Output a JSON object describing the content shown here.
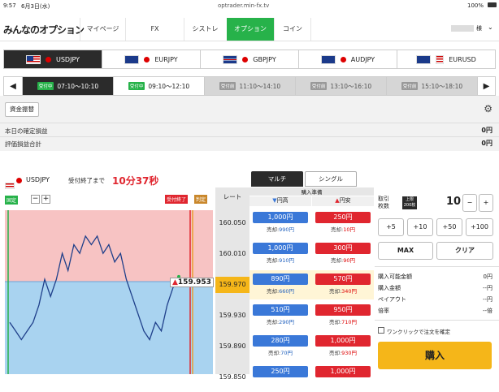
{
  "status": {
    "time": "9:57",
    "date": "6月3日(水)",
    "url": "optrader.min-fx.tv",
    "battery": "100%"
  },
  "nav": {
    "logo": "みんなのオプション",
    "items": [
      "マイページ",
      "FX",
      "シストレ",
      "オプション",
      "コイン"
    ],
    "active": "オプション",
    "user": "様"
  },
  "pairs": [
    "USDJPY",
    "EURJPY",
    "GBPJPY",
    "AUDJPY",
    "EURUSD"
  ],
  "active_pair": "USDJPY",
  "time_slots": [
    {
      "badge": "受付中",
      "time": "07:10〜10:10",
      "state": "dark"
    },
    {
      "badge": "受付中",
      "time": "09:10〜12:10",
      "state": "white"
    },
    {
      "badge": "受付前",
      "time": "11:10〜14:10",
      "state": "gray"
    },
    {
      "badge": "受付前",
      "time": "13:10〜16:10",
      "state": "gray"
    },
    {
      "badge": "受付前",
      "time": "15:10〜18:10",
      "state": "gray"
    }
  ],
  "account": {
    "transfer_label": "資金振替",
    "confirmed_label": "本日の確定損益",
    "confirmed_value": "0円",
    "valuation_label": "評価損益合計",
    "valuation_value": "0円"
  },
  "chart": {
    "pair": "USDJPY",
    "deadline_label": "受付終了まで",
    "countdown": "10分37秒",
    "scale_label": "固定",
    "end_label": "受付終了",
    "judge_label": "判定",
    "current_price": "159.953",
    "price_series": [
      159.9,
      159.89,
      159.88,
      159.89,
      159.9,
      159.92,
      159.95,
      159.93,
      159.95,
      159.98,
      159.96,
      159.99,
      159.98,
      160.0,
      159.99,
      160.0,
      159.98,
      159.99,
      159.97,
      159.98,
      159.95,
      159.93,
      159.91,
      159.89,
      159.88,
      159.9,
      159.89,
      159.92,
      159.94,
      159.953
    ]
  },
  "tabs": {
    "multi": "マルチ",
    "single": "シングル"
  },
  "table": {
    "rate_header": "レート",
    "ready_header": "購入準備",
    "high_header": "円高",
    "low_header": "円安",
    "rows": [
      {
        "rate": "160.050",
        "high": "1,000円",
        "high_sell": "990円",
        "low": "250円",
        "low_sell": "10円"
      },
      {
        "rate": "160.010",
        "high": "1,000円",
        "high_sell": "910円",
        "low": "300円",
        "low_sell": "90円"
      },
      {
        "rate": "159.970",
        "high": "890円",
        "high_sell": "660円",
        "low": "570円",
        "low_sell": "340円"
      },
      {
        "rate": "159.930",
        "high": "510円",
        "high_sell": "290円",
        "low": "950円",
        "low_sell": "710円"
      },
      {
        "rate": "159.890",
        "high": "280円",
        "high_sell": "70円",
        "low": "1,000円",
        "low_sell": "930円"
      },
      {
        "rate": "159.850",
        "high": "250円",
        "high_sell": "",
        "low": "1,000円",
        "low_sell": ""
      }
    ],
    "sell_prefix": "売却:"
  },
  "order": {
    "qty_label": "取引枚数",
    "limit_label": "上限200枚",
    "qty": "10",
    "minus": "−",
    "plus": "+",
    "add_buttons": [
      "+5",
      "+10",
      "+50",
      "+100"
    ],
    "max": "MAX",
    "clear": "クリア",
    "info": [
      {
        "label": "購入可能金額",
        "value": "0円"
      },
      {
        "label": "購入金額",
        "value": "--円"
      },
      {
        "label": "ペイアウト",
        "value": "--円"
      },
      {
        "label": "倍率",
        "value": "--倍"
      }
    ],
    "oneclick": "ワンクリックで注文を確定",
    "buy": "購入"
  },
  "colors": {
    "green": "#27b24a",
    "blue": "#3a78d8",
    "red": "#e0262f",
    "gold": "#f5b619"
  }
}
